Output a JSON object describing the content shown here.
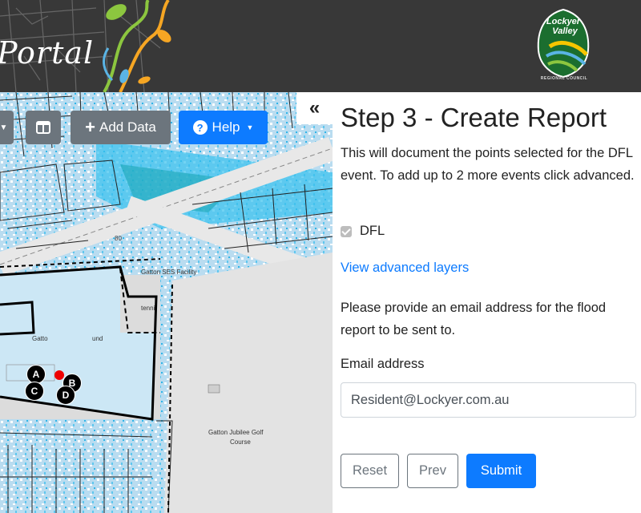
{
  "header": {
    "portal_text": "Portal",
    "logo_line1": "Lockyer",
    "logo_line2": "Valley",
    "logo_sub": "REGIONAL COUNCIL"
  },
  "map_toolbar": {
    "add_data_label": "Add Data",
    "help_label": "Help",
    "collapse_label": "«"
  },
  "map": {
    "labels": {
      "ses_facility": "Gatton SES Facility",
      "tennis": "tenni",
      "gatton": "Gatto",
      "ground": "und",
      "golf_course_1": "Gatton Jubilee Golf",
      "golf_course_2": "Course",
      "road_80": "80"
    },
    "markers": [
      {
        "letter": "A"
      },
      {
        "letter": "B"
      },
      {
        "letter": "C"
      },
      {
        "letter": "D"
      }
    ]
  },
  "panel": {
    "title": "Step 3 - Create Report",
    "intro": "This will document the points selected for the DFL event. To add up to 2 more events click advanced.",
    "dfl_label": "DFL",
    "dfl_checked": true,
    "advanced_link": "View advanced layers",
    "email_note": "Please provide an email address for the flood report to be sent to.",
    "email_label": "Email address",
    "email_value": "Resident@Lockyer.com.au",
    "reset_label": "Reset",
    "prev_label": "Prev",
    "submit_label": "Submit"
  },
  "colors": {
    "primary": "#0d7bff",
    "secondary": "#6c757d",
    "header_bg": "#383838"
  }
}
